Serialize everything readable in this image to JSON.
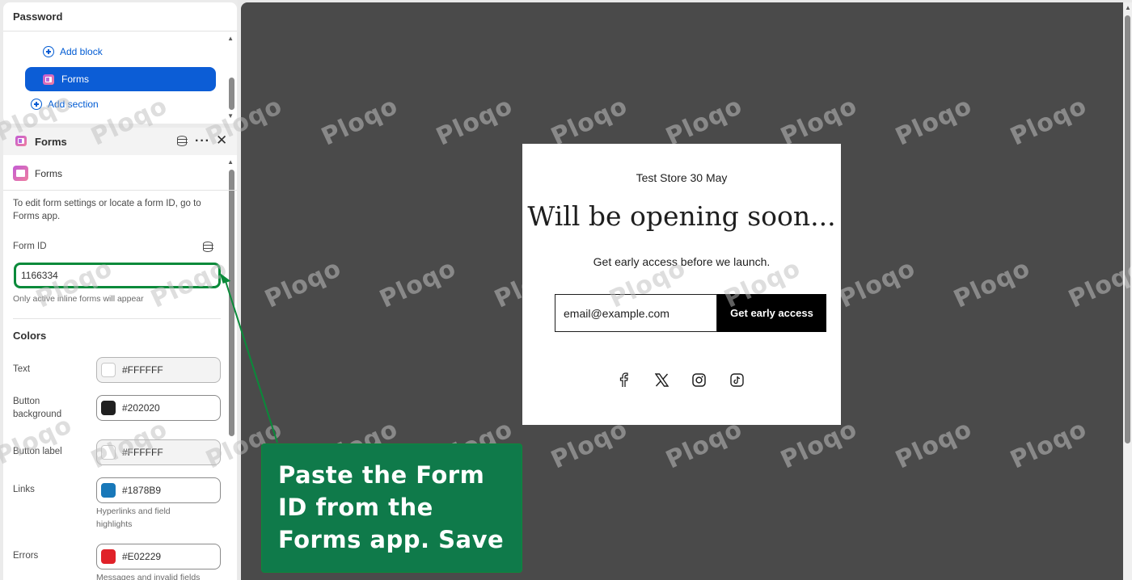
{
  "sidebar": {
    "section_title": "Password",
    "add_block": "Add block",
    "selected_block": "Forms",
    "add_section": "Add section"
  },
  "settings_panel": {
    "title": "Forms",
    "app_name": "Forms",
    "help_text": "To edit form settings or locate a form ID, go to Forms app.",
    "form_id_label": "Form ID",
    "form_id_value": "1166334",
    "form_id_hint": "Only active inline forms will appear",
    "colors_title": "Colors",
    "colors": [
      {
        "label": "Text",
        "value": "#FFFFFF",
        "swatch": "#FFFFFF",
        "hint": ""
      },
      {
        "label": "Button background",
        "value": "#202020",
        "swatch": "#202020",
        "hint": ""
      },
      {
        "label": "Button label",
        "value": "#FFFFFF",
        "swatch": "#FFFFFF",
        "hint": ""
      },
      {
        "label": "Links",
        "value": "#1878B9",
        "swatch": "#1878B9",
        "hint": "Hyperlinks and field highlights"
      },
      {
        "label": "Errors",
        "value": "#E02229",
        "swatch": "#E02229",
        "hint": "Messages and invalid fields"
      }
    ]
  },
  "preview": {
    "store_name": "Test Store 30 May",
    "headline": "Will be opening soon...",
    "subtext": "Get early access before we launch.",
    "email_placeholder": "email@example.com",
    "cta_label": "Get early access",
    "social_icons": [
      "facebook-icon",
      "x-icon",
      "instagram-icon",
      "tiktok-icon"
    ]
  },
  "callout": {
    "text": "Paste the Form ID from the Forms app. Save"
  },
  "watermark": "Ploqo",
  "colors": {
    "accent": "#005bd3",
    "selected_bg": "#0c5dd6",
    "callout_bg": "#0f7a4a",
    "highlight_border": "#0a8a3a",
    "preview_bg": "#4a4a4a"
  }
}
